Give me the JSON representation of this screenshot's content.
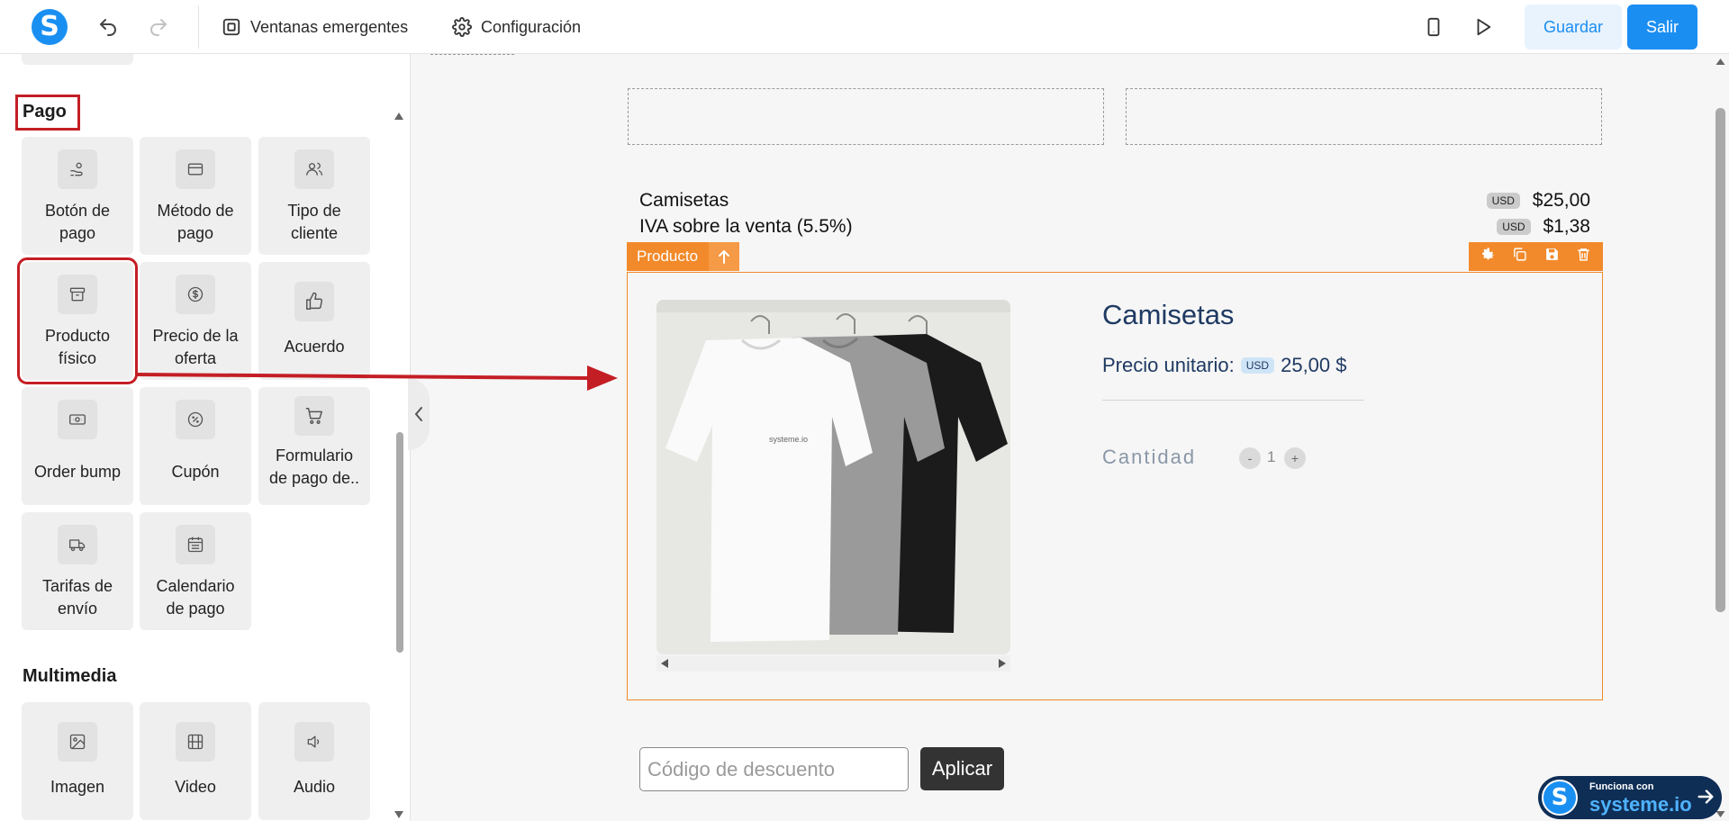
{
  "app": {
    "logo_letter": "S"
  },
  "topbar": {
    "popups_label": "Ventanas emergentes",
    "settings_label": "Configuración",
    "save_label": "Guardar",
    "exit_label": "Salir"
  },
  "sidebar": {
    "payment_section": "Pago",
    "payment_items": [
      {
        "line1": "Botón de",
        "line2": "pago",
        "icon": "hand-coin-icon"
      },
      {
        "line1": "Método de",
        "line2": "pago",
        "icon": "credit-card-icon"
      },
      {
        "line1": "Tipo de",
        "line2": "cliente",
        "icon": "users-icon"
      },
      {
        "line1": "Producto",
        "line2": "físico",
        "icon": "box-icon"
      },
      {
        "line1": "Precio de la",
        "line2": "oferta",
        "icon": "dollar-circle-icon"
      },
      {
        "line1": "Acuerdo",
        "line2": "",
        "icon": "thumbs-up-icon"
      },
      {
        "line1": "Order bump",
        "line2": "",
        "icon": "banknote-icon"
      },
      {
        "line1": "Cupón",
        "line2": "",
        "icon": "percent-badge-icon"
      },
      {
        "line1": "Formulario",
        "line2": "de pago de..",
        "icon": "cart-icon"
      },
      {
        "line1": "Tarifas de",
        "line2": "envío",
        "icon": "truck-icon"
      },
      {
        "line1": "Calendario",
        "line2": "de pago",
        "icon": "calendar-icon"
      }
    ],
    "media_section": "Multimedia",
    "media_items": [
      {
        "line1": "Imagen",
        "icon": "image-icon"
      },
      {
        "line1": "Video",
        "icon": "film-icon"
      },
      {
        "line1": "Audio",
        "icon": "speaker-icon"
      }
    ]
  },
  "order_summary": {
    "line1_name": "Camisetas",
    "line1_currency": "USD",
    "line1_price": "$25,00",
    "line2_name": "IVA sobre la venta (5.5%)",
    "line2_currency": "USD",
    "line2_price": "$1,38"
  },
  "product_block": {
    "tag_label": "Producto",
    "name": "Camisetas",
    "unit_price_label": "Precio unitario:",
    "currency": "USD",
    "unit_price": "25,00 $",
    "quantity_label": "Cantidad",
    "quantity_value": "1",
    "minus": "-",
    "plus": "+",
    "shirt_brand": "systeme.io"
  },
  "coupon": {
    "placeholder": "Código de descuento",
    "apply_label": "Aplicar"
  },
  "badge": {
    "small": "Funciona con",
    "big": "systeme.io"
  },
  "colors": {
    "accent": "#1b8ef2",
    "highlight": "#c41e25",
    "product_orange": "#f28a2b"
  }
}
